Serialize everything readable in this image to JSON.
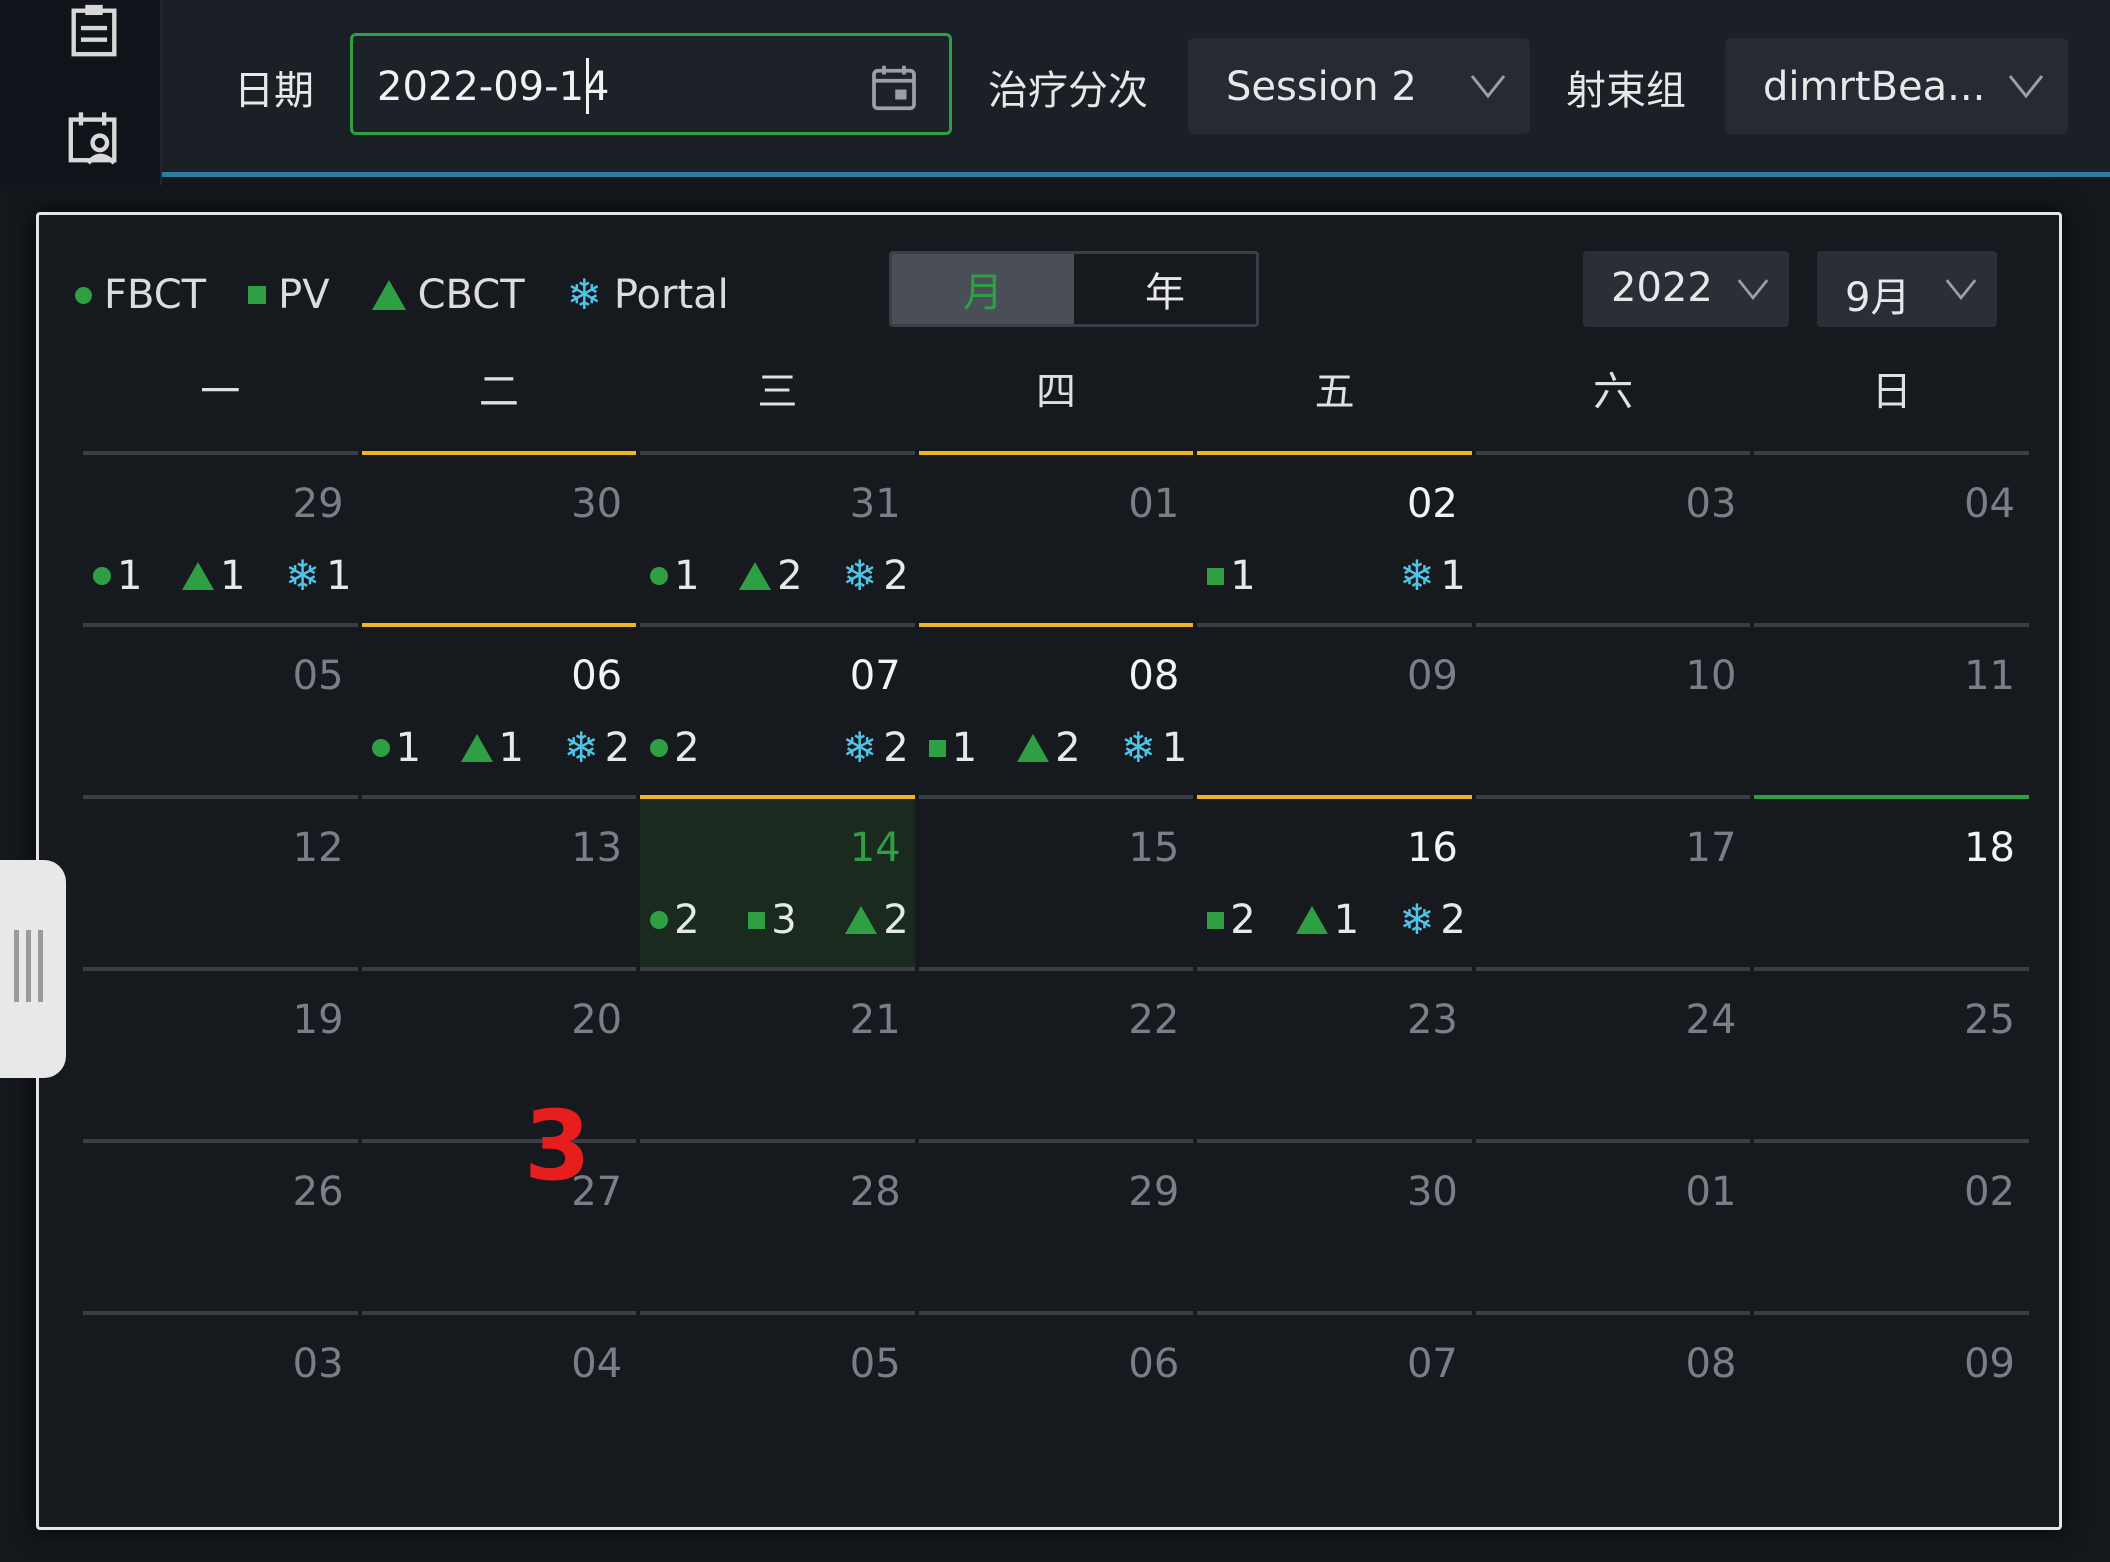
{
  "toolbar": {
    "date_label": "日期",
    "date_value": "2022-09-14",
    "session_label": "治疗分次",
    "session_value": "Session 2",
    "beam_label": "射束组",
    "beam_value": "dimrtBea..."
  },
  "legend": {
    "fbct": "FBCT",
    "pv": "PV",
    "cbct": "CBCT",
    "portal": "Portal"
  },
  "view_toggle": {
    "month": "月",
    "year": "年",
    "active": "月"
  },
  "year_select": "2022",
  "month_select": "9月",
  "weekdays": [
    "一",
    "二",
    "三",
    "四",
    "五",
    "六",
    "日"
  ],
  "colors": {
    "accent_green": "#2ea043",
    "highlight_yellow": "#f0b429",
    "portal_blue": "#4fc3e8"
  },
  "marker_label": "3",
  "days": [
    {
      "n": "29",
      "events": [
        [
          "dot",
          "1"
        ],
        [
          "tri",
          "1"
        ],
        [
          "flake",
          "1"
        ]
      ]
    },
    {
      "n": "30",
      "events": [],
      "border": "yellow"
    },
    {
      "n": "31",
      "events": [
        [
          "dot",
          "1"
        ],
        [
          "tri",
          "2"
        ],
        [
          "flake",
          "2"
        ]
      ]
    },
    {
      "n": "01",
      "events": [],
      "border": "yellow"
    },
    {
      "n": "02",
      "strong": true,
      "events": [
        [
          "sq",
          "1"
        ],
        [
          "flake",
          "1"
        ]
      ],
      "border": "yellow"
    },
    {
      "n": "03",
      "events": []
    },
    {
      "n": "04",
      "events": []
    },
    {
      "n": "05",
      "events": []
    },
    {
      "n": "06",
      "strong": true,
      "events": [
        [
          "dot",
          "1"
        ],
        [
          "tri",
          "1"
        ],
        [
          "flake",
          "2"
        ]
      ],
      "border": "yellow"
    },
    {
      "n": "07",
      "strong": true,
      "events": [
        [
          "dot",
          "2"
        ],
        [
          "flake",
          "2"
        ]
      ]
    },
    {
      "n": "08",
      "strong": true,
      "events": [
        [
          "sq",
          "1"
        ],
        [
          "tri",
          "2"
        ],
        [
          "flake",
          "1"
        ]
      ],
      "border": "yellow"
    },
    {
      "n": "09",
      "events": []
    },
    {
      "n": "10",
      "events": []
    },
    {
      "n": "11",
      "events": []
    },
    {
      "n": "12",
      "events": []
    },
    {
      "n": "13",
      "events": []
    },
    {
      "n": "14",
      "today": true,
      "events": [
        [
          "dot",
          "2"
        ],
        [
          "sq",
          "3"
        ],
        [
          "tri",
          "2"
        ]
      ],
      "border": "yellow"
    },
    {
      "n": "15",
      "events": []
    },
    {
      "n": "16",
      "strong": true,
      "events": [
        [
          "sq",
          "2"
        ],
        [
          "tri",
          "1"
        ],
        [
          "flake",
          "2"
        ]
      ],
      "border": "yellow"
    },
    {
      "n": "17",
      "events": []
    },
    {
      "n": "18",
      "strong": true,
      "events": [],
      "border": "green"
    },
    {
      "n": "19",
      "events": []
    },
    {
      "n": "20",
      "events": []
    },
    {
      "n": "21",
      "events": []
    },
    {
      "n": "22",
      "events": []
    },
    {
      "n": "23",
      "events": []
    },
    {
      "n": "24",
      "events": []
    },
    {
      "n": "25",
      "events": []
    },
    {
      "n": "26",
      "events": []
    },
    {
      "n": "27",
      "events": []
    },
    {
      "n": "28",
      "events": []
    },
    {
      "n": "29",
      "events": []
    },
    {
      "n": "30",
      "events": []
    },
    {
      "n": "01",
      "events": []
    },
    {
      "n": "02",
      "events": []
    },
    {
      "n": "03",
      "events": []
    },
    {
      "n": "04",
      "events": []
    },
    {
      "n": "05",
      "events": []
    },
    {
      "n": "06",
      "events": []
    },
    {
      "n": "07",
      "events": []
    },
    {
      "n": "08",
      "events": []
    },
    {
      "n": "09",
      "events": []
    }
  ]
}
